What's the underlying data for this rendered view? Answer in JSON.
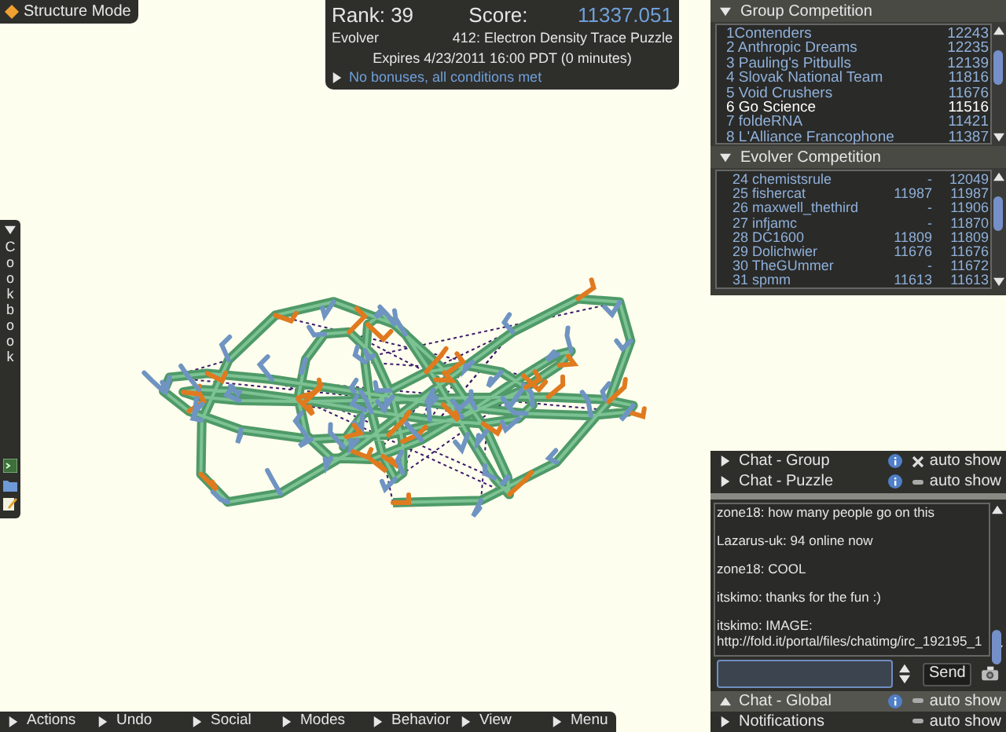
{
  "mode_button": {
    "label": "Structure Mode"
  },
  "score_panel": {
    "rank": "Rank: 39",
    "score_label": "Score:",
    "score": "11337.051",
    "player_class": "Evolver",
    "puzzle": "412: Electron Density Trace Puzzle",
    "expires": "Expires 4/23/2011 16:00 PDT (0 minutes)",
    "bonuses": "No bonuses, all conditions met",
    "bonuses_expanded": false
  },
  "group_competition": {
    "title": "Group Competition",
    "expanded": true,
    "rows": [
      {
        "name": "1Contenders",
        "score": "12243",
        "selected": false
      },
      {
        "name": "2 Anthropic Dreams",
        "score": "12235",
        "selected": false
      },
      {
        "name": "3 Pauling's Pitbulls",
        "score": "12139",
        "selected": false
      },
      {
        "name": "4 Slovak National Team",
        "score": "11816",
        "selected": false
      },
      {
        "name": "5 Void Crushers",
        "score": "11676",
        "selected": false
      },
      {
        "name": "6 Go Science",
        "score": "11516",
        "selected": true
      },
      {
        "name": "7 foldeRNA",
        "score": "11421",
        "selected": false
      },
      {
        "name": "8 L'Alliance Francophone",
        "score": "11387",
        "selected": false
      }
    ]
  },
  "evolver_competition": {
    "title": "Evolver Competition",
    "expanded": true,
    "rows": [
      {
        "name": "24 chemistsrule",
        "column_2": "-",
        "score": "12049"
      },
      {
        "name": "25 fishercat",
        "column_2": "11987",
        "score": "11987"
      },
      {
        "name": "26 maxwell_thethird",
        "column_2": "-",
        "score": "11906"
      },
      {
        "name": "27 infjamc",
        "column_2": "-",
        "score": "11870"
      },
      {
        "name": "28 DC1600",
        "column_2": "11809",
        "score": "11809"
      },
      {
        "name": "29 Dolichwier",
        "column_2": "11676",
        "score": "11676"
      },
      {
        "name": "30 TheGUmmer",
        "column_2": "-",
        "score": "11672"
      },
      {
        "name": "31 spmm",
        "column_2": "11613",
        "score": "11613"
      }
    ]
  },
  "cookbook": {
    "label": "Cookbook",
    "expanded": true
  },
  "chat_tabs": [
    {
      "label": "Chat - Group",
      "selected": false,
      "expanded": false,
      "info": true,
      "auto_show": true,
      "auto_show_label": "auto show"
    },
    {
      "label": "Chat - Puzzle",
      "selected": false,
      "expanded": false,
      "info": true,
      "auto_show": false,
      "auto_show_label": "auto show"
    }
  ],
  "chat_messages": [
    "zone18: how many people go on this",
    "Lazarus-uk: 94 online now",
    "zone18: COOL",
    "itskimo: thanks for the fun :)",
    "itskimo: IMAGE: http://fold.it/portal/files/chatimg/irc_192195_1"
  ],
  "chat_send": "Send",
  "chat_tabs_bottom": [
    {
      "label": "Chat - Global",
      "selected": true,
      "expanded": true,
      "info": true,
      "auto_show": false,
      "auto_show_label": "auto show"
    },
    {
      "label": "Notifications",
      "selected": false,
      "expanded": false,
      "info": false,
      "auto_show": false,
      "auto_show_label": "auto show"
    }
  ],
  "menu_bar": [
    "Actions",
    "Undo",
    "Social",
    "Modes",
    "Behavior",
    "View",
    "Menu"
  ]
}
